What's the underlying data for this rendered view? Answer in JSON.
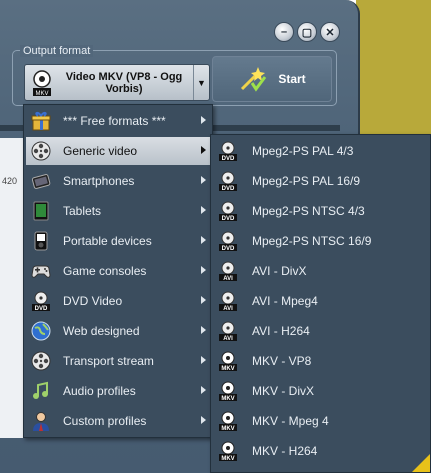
{
  "output_format": {
    "label": "Output format",
    "selected": "Video MKV (VP8 - Ogg Vorbis)",
    "dropdown_arrow": "▼",
    "icon": "mkv-icon"
  },
  "start_button": {
    "label": "Start",
    "icon": "magic-wand-icon"
  },
  "window_controls": {
    "minimize": "–",
    "restore": "▢",
    "close": "✕"
  },
  "background_fragment": "420",
  "menu_main": [
    {
      "label": "*** Free formats ***",
      "icon": "gift-icon",
      "submenu": true,
      "active": false
    },
    {
      "label": "Generic video",
      "icon": "film-reel-icon",
      "submenu": true,
      "active": true
    },
    {
      "label": "Smartphones",
      "icon": "smartphone-icon",
      "submenu": true,
      "active": false
    },
    {
      "label": "Tablets",
      "icon": "tablet-icon",
      "submenu": true,
      "active": false
    },
    {
      "label": "Portable devices",
      "icon": "media-player-icon",
      "submenu": true,
      "active": false
    },
    {
      "label": "Game consoles",
      "icon": "gamepad-icon",
      "submenu": true,
      "active": false
    },
    {
      "label": "DVD Video",
      "icon": "dvd-icon",
      "submenu": true,
      "active": false
    },
    {
      "label": "Web designed",
      "icon": "globe-icon",
      "submenu": true,
      "active": false
    },
    {
      "label": "Transport stream",
      "icon": "film-reel-icon",
      "submenu": true,
      "active": false
    },
    {
      "label": "Audio profiles",
      "icon": "music-note-icon",
      "submenu": true,
      "active": false
    },
    {
      "label": "Custom profiles",
      "icon": "user-profile-icon",
      "submenu": true,
      "active": false
    }
  ],
  "menu_generic_video": [
    {
      "label": "Mpeg2-PS PAL 4/3",
      "icon": "dvd-icon"
    },
    {
      "label": "Mpeg2-PS PAL 16/9",
      "icon": "dvd-icon"
    },
    {
      "label": "Mpeg2-PS NTSC 4/3",
      "icon": "dvd-icon"
    },
    {
      "label": "Mpeg2-PS NTSC 16/9",
      "icon": "dvd-icon"
    },
    {
      "label": "AVI - DivX",
      "icon": "avi-icon"
    },
    {
      "label": "AVI - Mpeg4",
      "icon": "avi-icon"
    },
    {
      "label": "AVI - H264",
      "icon": "avi-icon"
    },
    {
      "label": "MKV - VP8",
      "icon": "mkv-icon"
    },
    {
      "label": "MKV - DivX",
      "icon": "mkv-icon"
    },
    {
      "label": "MKV - Mpeg 4",
      "icon": "mkv-icon"
    },
    {
      "label": "MKV - H264",
      "icon": "mkv-icon"
    }
  ],
  "colors": {
    "menu_bg": "#3b4d5e",
    "window_bg": "#4a6075",
    "desktop_accent": "#b8a93a",
    "active_item_bg": "#c9d0d7"
  }
}
